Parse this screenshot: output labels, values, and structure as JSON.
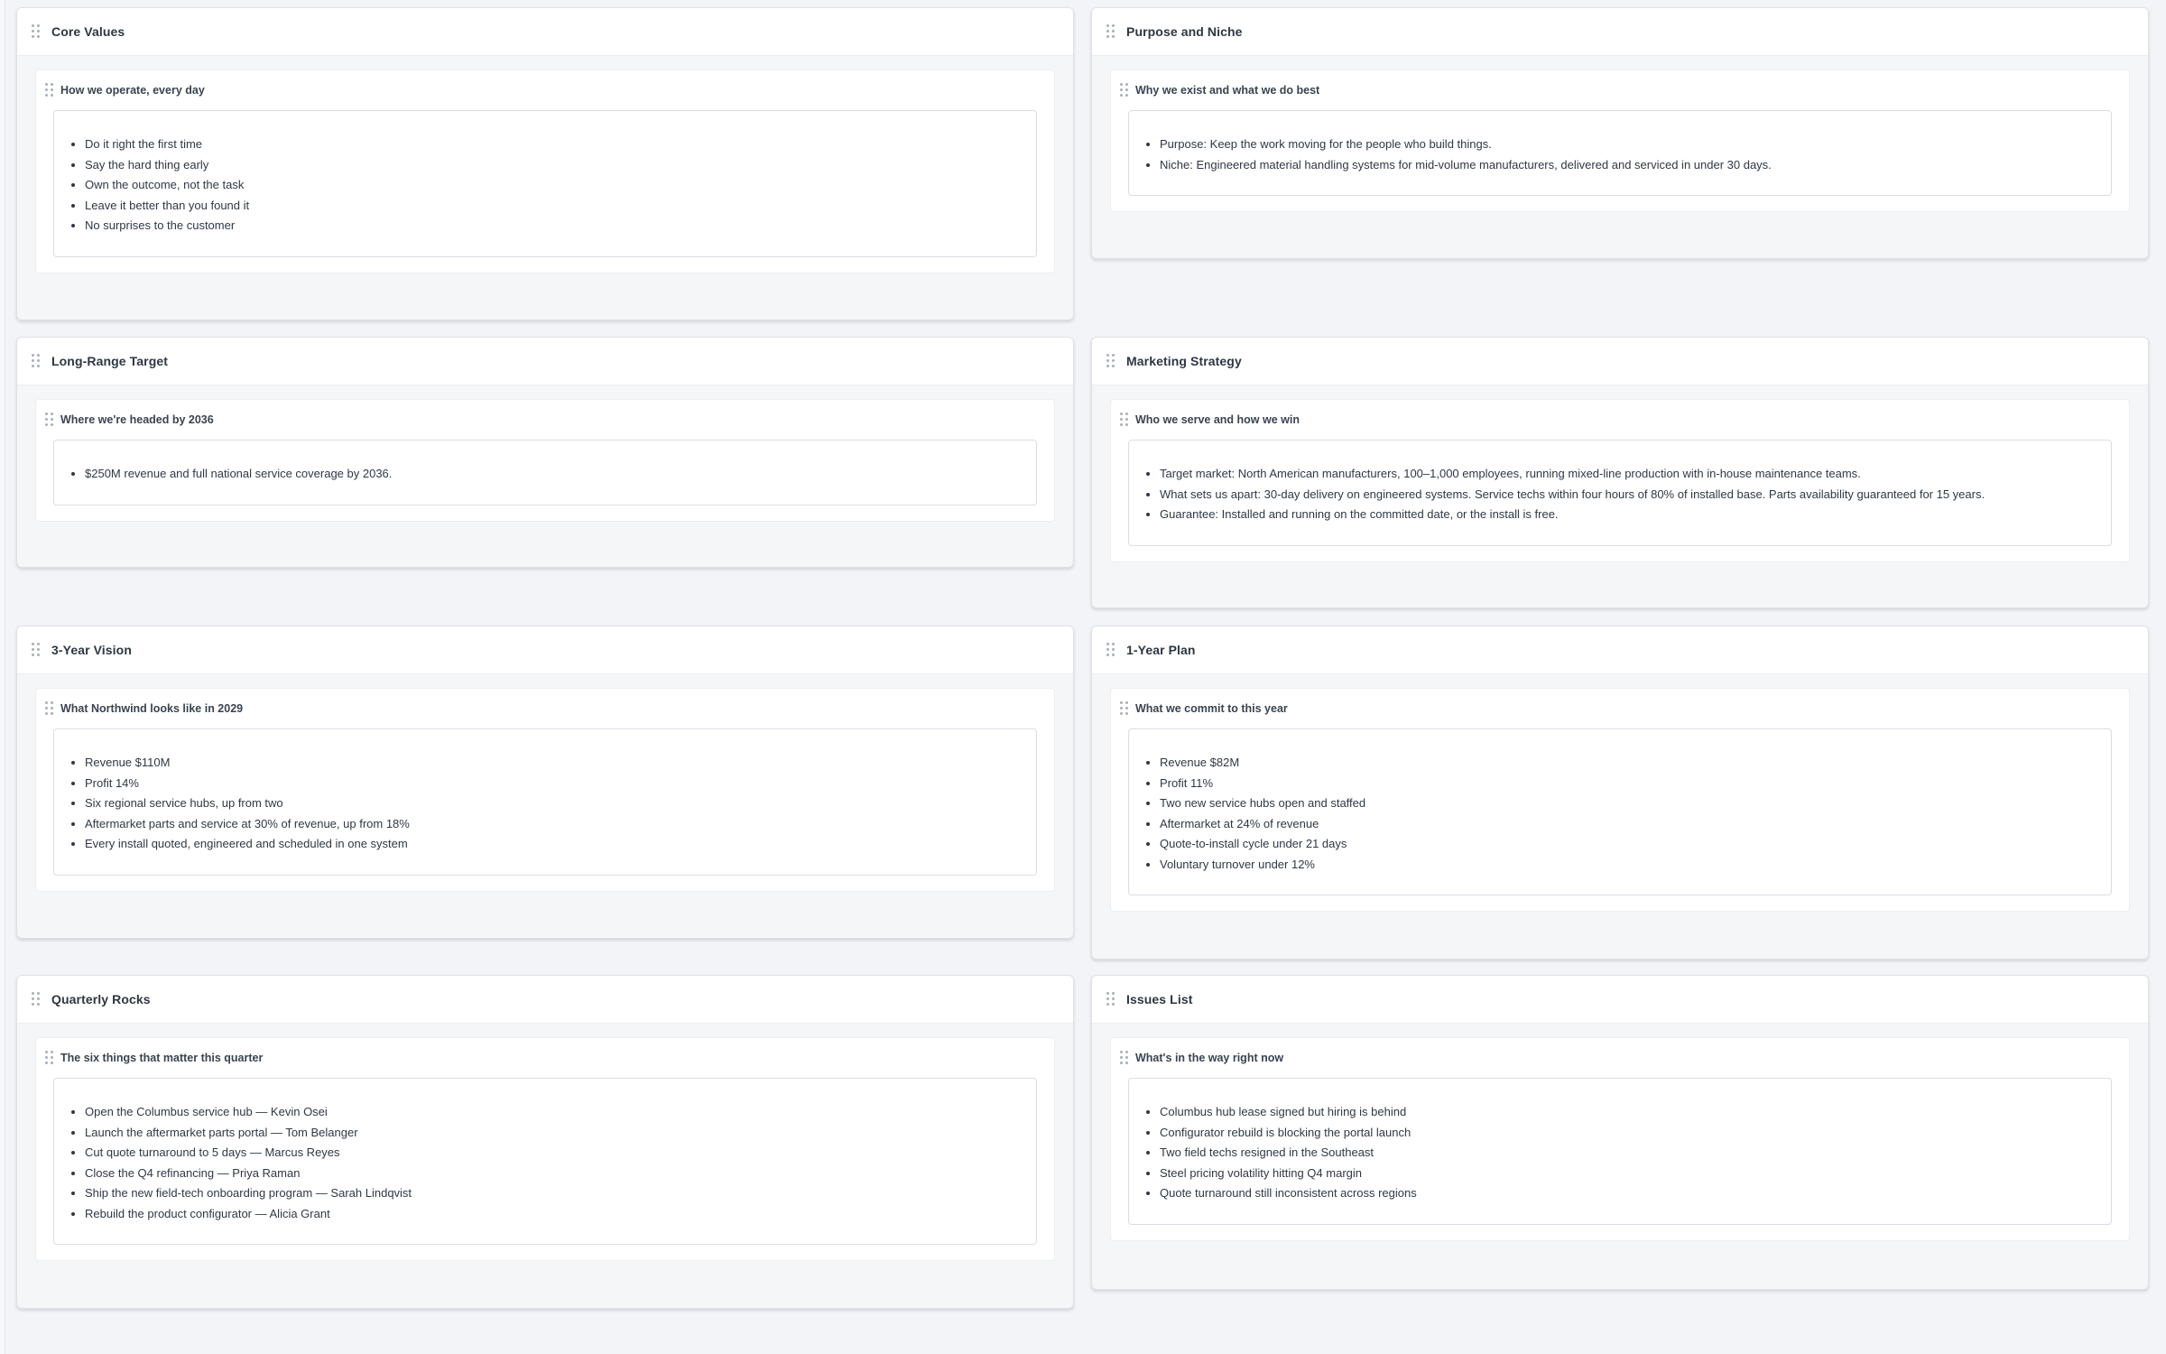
{
  "panels": {
    "core_values": {
      "title": "Core Values",
      "section_title": "How we operate, every day",
      "items": [
        "Do it right the first time",
        "Say the hard thing early",
        "Own the outcome, not the task",
        "Leave it better than you found it",
        "No surprises to the customer"
      ]
    },
    "purpose_niche": {
      "title": "Purpose and Niche",
      "section_title": "Why we exist and what we do best",
      "items": [
        "Purpose: Keep the work moving for the people who build things.",
        "Niche: Engineered material handling systems for mid-volume manufacturers, delivered and serviced in under 30 days."
      ]
    },
    "long_range": {
      "title": "Long-Range Target",
      "section_title": "Where we're headed by 2036",
      "items": [
        "$250M revenue and full national service coverage by 2036."
      ]
    },
    "marketing": {
      "title": "Marketing Strategy",
      "section_title": "Who we serve and how we win",
      "items": [
        "Target market: North American manufacturers, 100–1,000 employees, running mixed-line production with in-house maintenance teams.",
        "What sets us apart: 30-day delivery on engineered systems. Service techs within four hours of 80% of installed base. Parts availability guaranteed for 15 years.",
        "Guarantee: Installed and running on the committed date, or the install is free."
      ]
    },
    "three_year": {
      "title": "3-Year Vision",
      "section_title": "What Northwind looks like in 2029",
      "items": [
        "Revenue $110M",
        "Profit 14%",
        "Six regional service hubs, up from two",
        "Aftermarket parts and service at 30% of revenue, up from 18%",
        "Every install quoted, engineered and scheduled in one system"
      ]
    },
    "one_year": {
      "title": "1-Year Plan",
      "section_title": "What we commit to this year",
      "items": [
        "Revenue $82M",
        "Profit 11%",
        "Two new service hubs open and staffed",
        "Aftermarket at 24% of revenue",
        "Quote-to-install cycle under 21 days",
        "Voluntary turnover under 12%"
      ]
    },
    "rocks": {
      "title": "Quarterly Rocks",
      "section_title": "The six things that matter this quarter",
      "items": [
        "Open the Columbus service hub — Kevin Osei",
        "Launch the aftermarket parts portal — Tom Belanger",
        "Cut quote turnaround to 5 days — Marcus Reyes",
        "Close the Q4 refinancing — Priya Raman",
        "Ship the new field-tech onboarding program — Sarah Lindqvist",
        "Rebuild the product configurator — Alicia Grant"
      ]
    },
    "issues": {
      "title": "Issues List",
      "section_title": "What's in the way right now",
      "items": [
        "Columbus hub lease signed but hiring is behind",
        "Configurator rebuild is blocking the portal launch",
        "Two field techs resigned in the Southeast",
        "Steel pricing volatility hitting Q4 margin",
        "Quote turnaround still inconsistent across regions"
      ]
    }
  }
}
